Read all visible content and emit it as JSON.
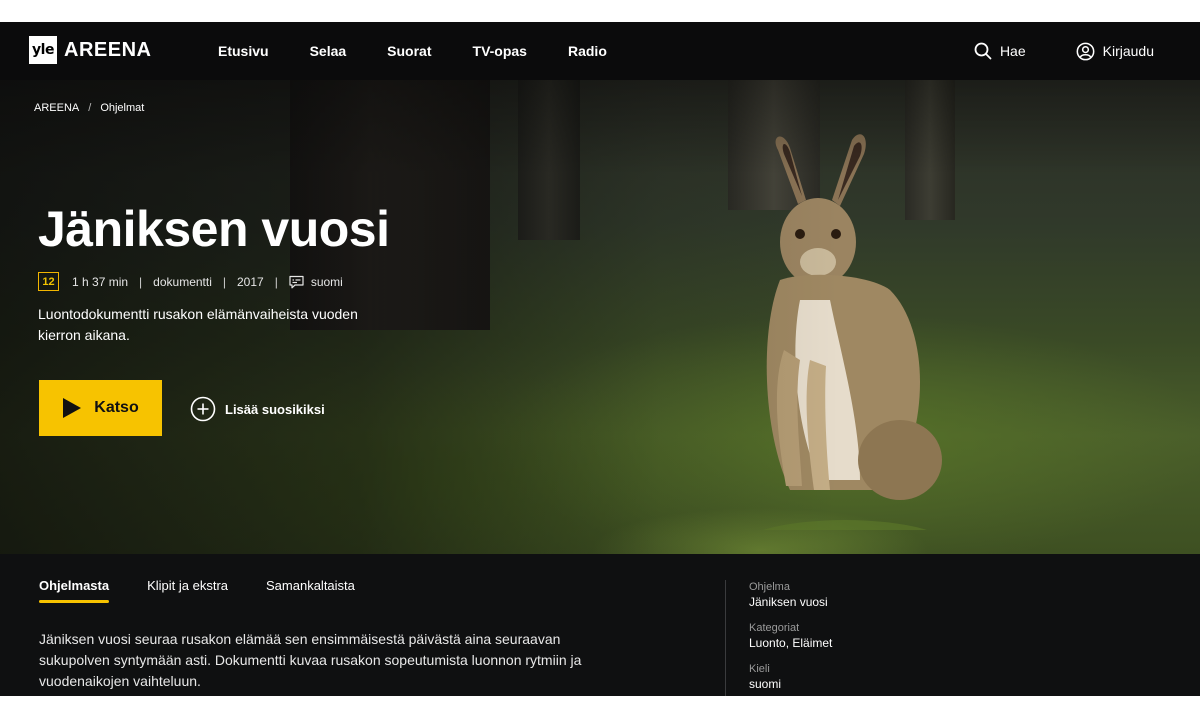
{
  "header": {
    "logo_yle": "yle",
    "logo_areena": "AREENA",
    "nav": [
      "Etusivu",
      "Selaa",
      "Suorat",
      "TV-opas",
      "Radio"
    ],
    "search_label": "Hae",
    "login_label": "Kirjaudu"
  },
  "breadcrumb": {
    "home": "AREENA",
    "separator": "/",
    "current": "Ohjelmat"
  },
  "program": {
    "title": "Jäniksen vuosi",
    "age_rating": "12",
    "duration": "1 h 37 min",
    "genre": "dokumentti",
    "year": "2017",
    "subtitles": "suomi",
    "short_description": "Luontodokumentti rusakon elämänvaiheista vuoden kierron aikana.",
    "watch_label": "Katso",
    "favorite_label": "Lisää suosikiksi"
  },
  "tabs": [
    {
      "label": "Ohjelmasta",
      "active": true
    },
    {
      "label": "Klipit ja ekstra",
      "active": false
    },
    {
      "label": "Samankaltaista",
      "active": false
    }
  ],
  "long_description": "Jäniksen vuosi seuraa rusakon elämää sen ensimmäisestä päivästä aina seuraavan sukupolven syntymään asti. Dokumentti kuvaa rusakon sopeutumista luonnon rytmiin ja vuodenaikojen vaihteluun.",
  "info": {
    "program_label": "Ohjelma",
    "program_value": "Jäniksen vuosi",
    "categories_label": "Kategoriat",
    "categories_value": "Luonto, Eläimet",
    "language_label": "Kieli",
    "language_value": "suomi"
  },
  "colors": {
    "accent": "#f7c300",
    "background": "#0e0f10"
  },
  "icons": {
    "search": "search-icon",
    "user": "user-icon",
    "subtitles": "subtitles-icon",
    "play": "play-icon",
    "add": "plus-circle-icon"
  }
}
